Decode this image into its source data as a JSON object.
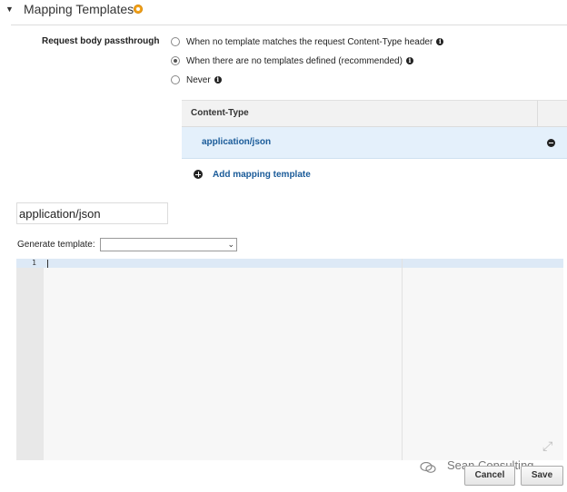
{
  "section": {
    "title": "Mapping Templates",
    "caret_icon": "caret-down-icon",
    "badge_icon": "warning-dot-icon",
    "badge_color": "#f2a21b"
  },
  "passthrough": {
    "label": "Request body passthrough",
    "options": [
      {
        "label": "When no template matches the request Content-Type header",
        "selected": false
      },
      {
        "label": "When there are no templates defined (recommended)",
        "selected": true
      },
      {
        "label": "Never",
        "selected": false
      }
    ],
    "info_glyph": "i"
  },
  "content_type_table": {
    "header": "Content-Type",
    "rows": [
      "application/json"
    ],
    "row_highlight": "#e4f0fb",
    "link_color": "#1a5b99"
  },
  "add_mapping_label": "Add mapping template",
  "content_type_input_value": "application/json",
  "generate_template": {
    "label": "Generate template:",
    "selected": ""
  },
  "editor": {
    "line_numbers": [
      "1"
    ],
    "content": ""
  },
  "watermark": "Sean Consulting",
  "buttons": {
    "cancel": "Cancel",
    "save": "Save"
  }
}
